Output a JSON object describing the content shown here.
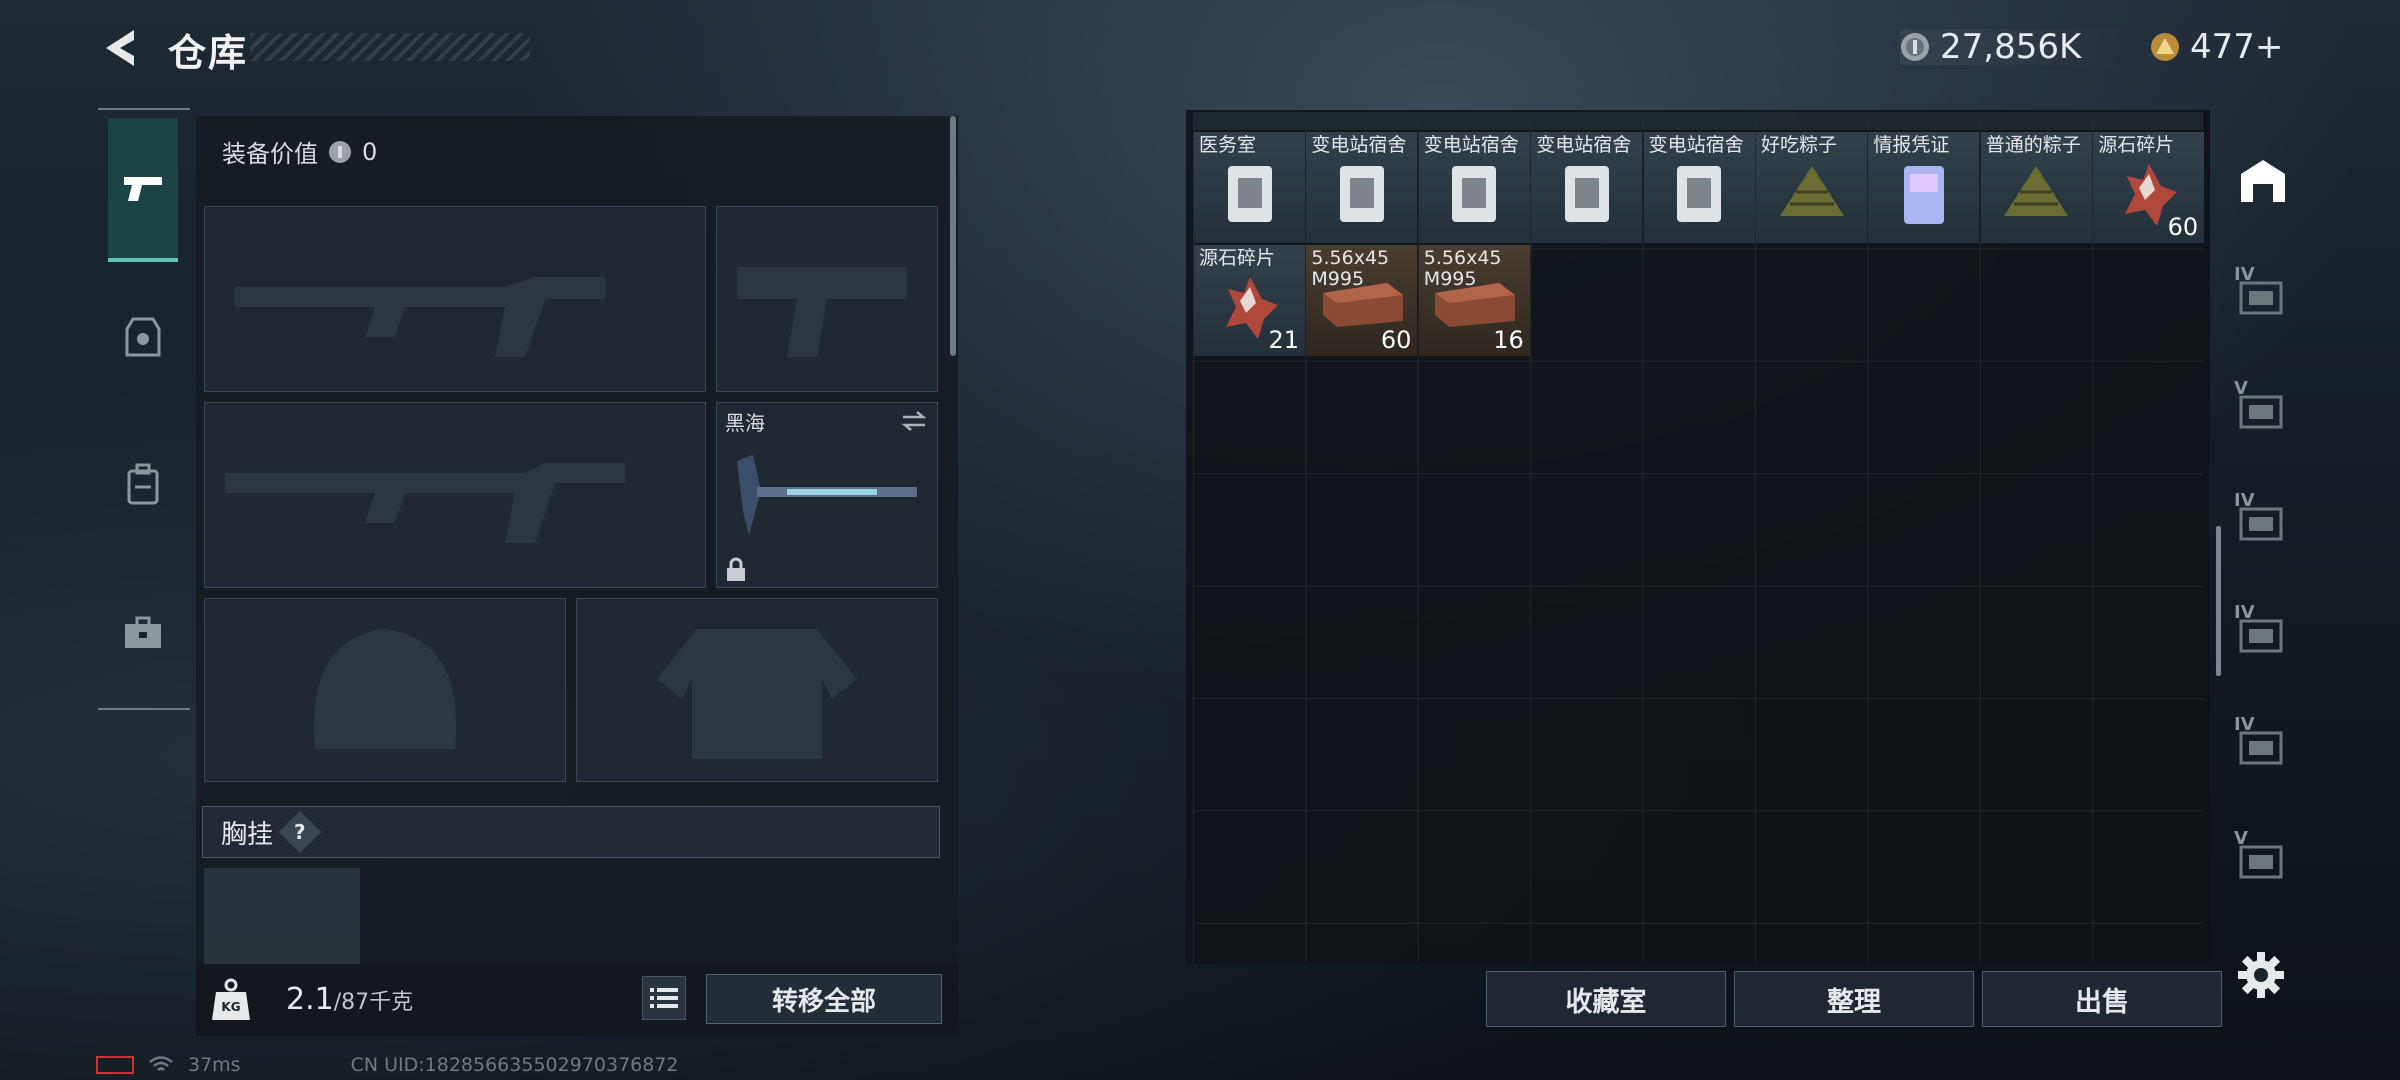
{
  "header": {
    "title": "仓库"
  },
  "currency": {
    "coin_amount": "27,856K",
    "gem_amount": "477+"
  },
  "loadout": {
    "equip_value_label": "装备价值",
    "equip_value": "0",
    "melee_name": "黑海",
    "chest_label": "胸挂",
    "chest_help": "?",
    "weight_current": "2.1",
    "weight_max": "/87千克",
    "transfer_all": "转移全部",
    "kg_badge": "KG"
  },
  "stash": {
    "row1": [
      {
        "name": "医务室",
        "qty": "",
        "kind": "keycard"
      },
      {
        "name": "变电站宿舍",
        "qty": "",
        "kind": "keycard"
      },
      {
        "name": "变电站宿舍",
        "qty": "",
        "kind": "keycard"
      },
      {
        "name": "变电站宿舍",
        "qty": "",
        "kind": "keycard"
      },
      {
        "name": "变电站宿舍",
        "qty": "",
        "kind": "keycard"
      },
      {
        "name": "好吃粽子",
        "qty": "",
        "kind": "zongzi"
      },
      {
        "name": "情报凭证",
        "qty": "",
        "kind": "card"
      },
      {
        "name": "普通的粽子",
        "qty": "",
        "kind": "zongzi"
      },
      {
        "name": "源石碎片",
        "qty": "60",
        "kind": "shard"
      }
    ],
    "row2": [
      {
        "name": "源石碎片",
        "qty": "21",
        "kind": "shard"
      },
      {
        "name": "5.56x45\nM995",
        "qty": "60",
        "kind": "ammo"
      },
      {
        "name": "5.56x45\nM995",
        "qty": "16",
        "kind": "ammo"
      }
    ]
  },
  "right_tabs": [
    "IV",
    "V",
    "IV",
    "IV",
    "IV",
    "V"
  ],
  "buttons": {
    "collection": "收藏室",
    "sort": "整理",
    "sell": "出售"
  },
  "status": {
    "ping": "37ms",
    "uid": "CN UID:1828566355029703768​72"
  },
  "icons": {
    "back": "back-arrow-icon",
    "coin": "silver-coin-icon",
    "gem": "gold-triangle-icon",
    "settings": "gear-icon"
  },
  "colors": {
    "accent": "#5ec5b7",
    "common_cell": "#33414c",
    "ammo_cell": "#4a3d30"
  }
}
